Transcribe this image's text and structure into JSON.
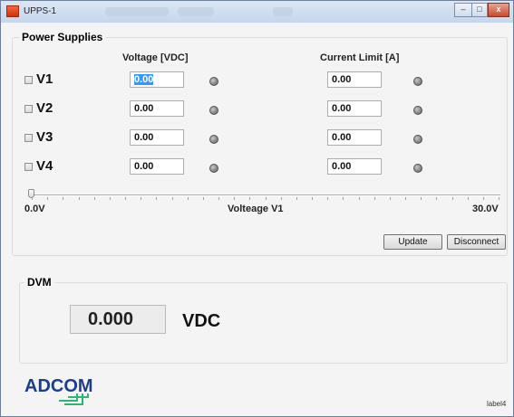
{
  "window": {
    "title": "UPPS-1",
    "minimize": "–",
    "maximize": "□",
    "close": "x"
  },
  "power_supplies": {
    "title": "Power Supplies",
    "voltage_header": "Voltage [VDC]",
    "current_header": "Current Limit [A]",
    "rows": [
      {
        "label": "V1",
        "voltage": "0.00",
        "current": "0.00",
        "checked": false
      },
      {
        "label": "V2",
        "voltage": "0.00",
        "current": "0.00",
        "checked": false
      },
      {
        "label": "V3",
        "voltage": "0.00",
        "current": "0.00",
        "checked": false
      },
      {
        "label": "V4",
        "voltage": "0.00",
        "current": "0.00",
        "checked": false
      }
    ],
    "slider": {
      "min_label": "0.0V",
      "caption": "Volteage V1",
      "max_label": "30.0V",
      "value": 0
    },
    "update_label": "Update",
    "disconnect_label": "Disconnect"
  },
  "dvm": {
    "title": "DVM",
    "value": "0.000",
    "unit": "VDC"
  },
  "logo": {
    "text": "ADCOM",
    "color": "#1c3f8a",
    "accent": "#2bb673"
  },
  "footer": {
    "label": "label4"
  }
}
